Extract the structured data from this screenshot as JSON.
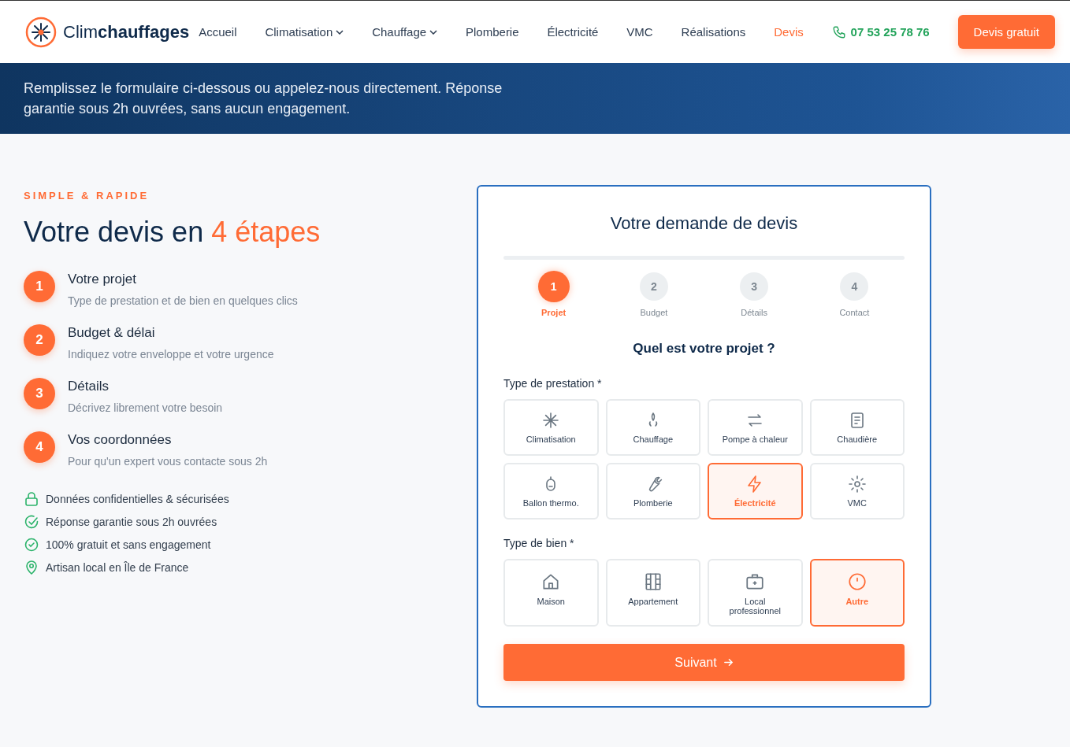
{
  "header": {
    "logo": "Clim**chauffages**",
    "nav": [
      {
        "label": "Accueil",
        "dropdown": false,
        "selected": false
      },
      {
        "label": "Climatisation",
        "dropdown": true,
        "selected": false
      },
      {
        "label": "Chauffage",
        "dropdown": true,
        "selected": false
      },
      {
        "label": "Plomberie",
        "dropdown": false,
        "selected": false
      },
      {
        "label": "Électricité",
        "dropdown": false,
        "selected": false
      },
      {
        "label": "VMC",
        "dropdown": false,
        "selected": false
      },
      {
        "label": "Réalisations",
        "dropdown": false,
        "selected": false
      },
      {
        "label": "Devis",
        "dropdown": false,
        "selected": true
      }
    ],
    "phone": "07 53 25 78 76",
    "cta": "Devis gratuit"
  },
  "hero": {
    "lines": [
      "Remplissez le formulaire ci-dessous ou appelez-nous directement. Réponse",
      "garantie sous 2h ouvrées, sans aucun engagement."
    ]
  },
  "intro": {
    "eyebrow": "SIMPLE & RAPIDE",
    "title": "Votre devis en ",
    "title_accent": "4 étapes",
    "steps": [
      {
        "number": "1",
        "title": "Votre projet",
        "text": "Type de prestation et de bien en quelques clics"
      },
      {
        "number": "2",
        "title": "Budget & délai",
        "text": "Indiquez votre enveloppe et votre urgence"
      },
      {
        "number": "3",
        "title": "Détails",
        "text": "Décrivez librement votre besoin"
      },
      {
        "number": "4",
        "title": "Vos coordonnées",
        "text": "Pour qu'un expert vous contacte sous 2h"
      }
    ],
    "assurances": [
      "Données confidentielles & sécurisées",
      "Réponse garantie sous 2h ouvrées",
      "100% gratuit et sans engagement",
      "Artisan local en Île de France"
    ]
  },
  "form": {
    "title": "Votre demande de devis",
    "stepper": [
      {
        "number": "1",
        "label": "Projet",
        "selected": true
      },
      {
        "number": "2",
        "label": "Budget",
        "selected": false
      },
      {
        "number": "3",
        "label": "Détails",
        "selected": false
      },
      {
        "number": "4",
        "label": "Contact",
        "selected": false
      }
    ],
    "question": "Quel est votre projet ?",
    "service_label": "Type de prestation *",
    "services": [
      {
        "label": "Climatisation",
        "selected": false
      },
      {
        "label": "Chauffage",
        "selected": false
      },
      {
        "label": "Pompe à chaleur",
        "selected": false
      },
      {
        "label": "Chaudière",
        "selected": false
      },
      {
        "label": "Ballon thermo.",
        "selected": false
      },
      {
        "label": "Plomberie",
        "selected": false
      },
      {
        "label": "Électricité",
        "selected": true
      },
      {
        "label": "VMC",
        "selected": false
      }
    ],
    "property_label": "Type de bien *",
    "properties": [
      {
        "label": "Maison",
        "selected": false
      },
      {
        "label": "Appartement",
        "selected": false
      },
      {
        "label": "Local professionnel",
        "selected": false
      },
      {
        "label": "Autre",
        "selected": true
      }
    ],
    "next": "Suivant"
  }
}
